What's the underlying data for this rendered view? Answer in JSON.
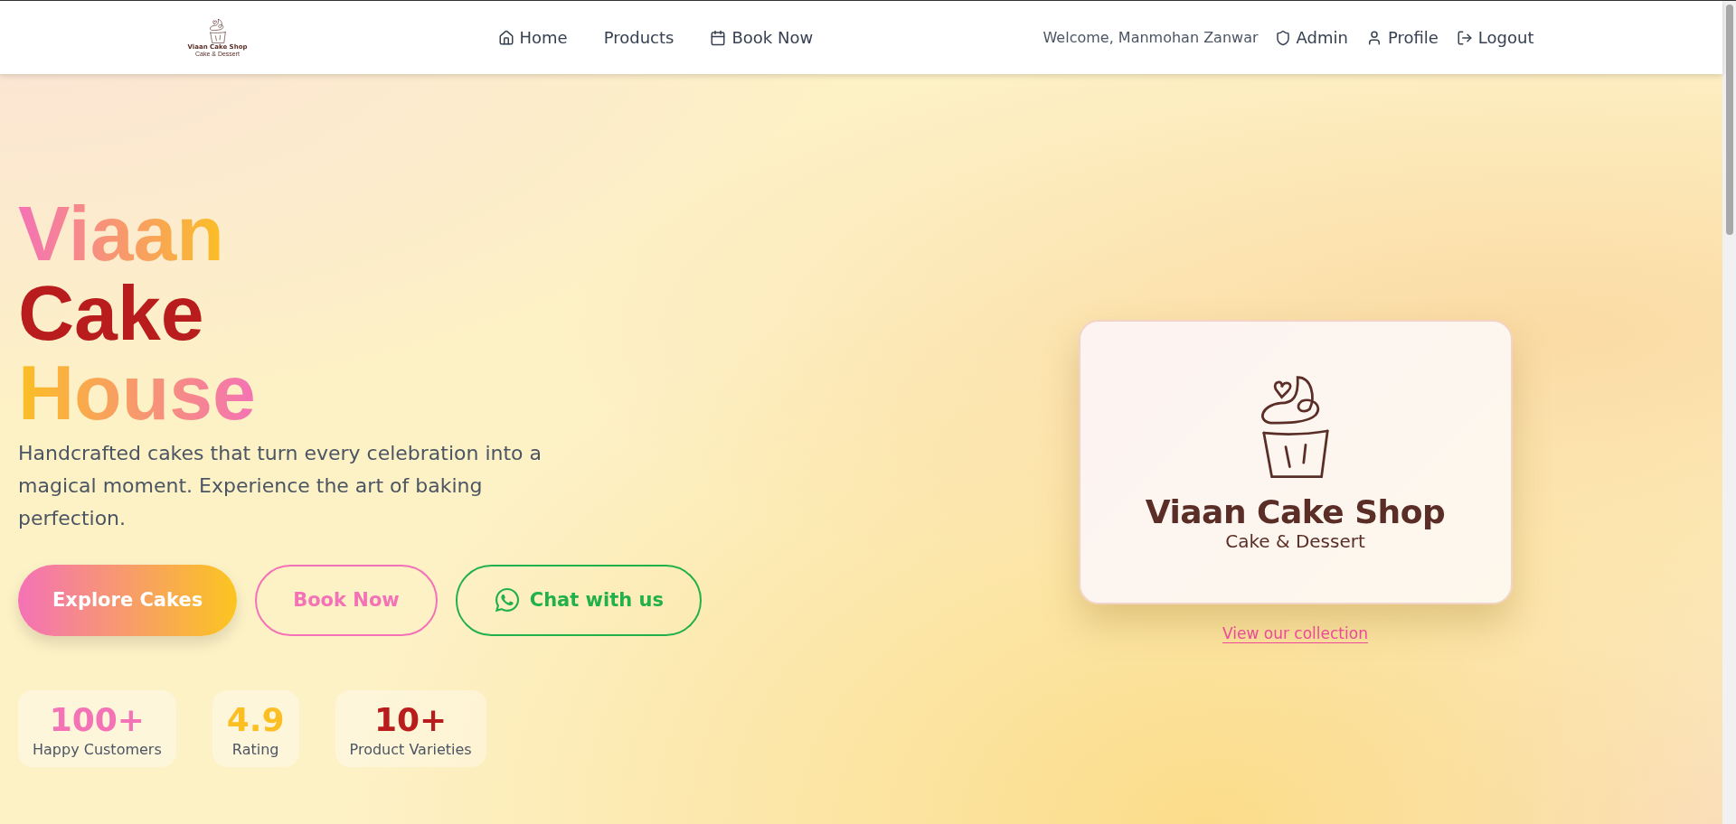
{
  "header": {
    "logo": {
      "name": "Viaan Cake Shop",
      "tagline": "Cake & Dessert"
    },
    "nav": [
      {
        "label": "Home",
        "kind": "home"
      },
      {
        "label": "Products",
        "kind": "plain"
      },
      {
        "label": "Book Now",
        "kind": "calendar"
      }
    ],
    "welcome": "Welcome, Manmohan Zanwar",
    "actions": [
      {
        "label": "Admin",
        "kind": "shield"
      },
      {
        "label": "Profile",
        "kind": "user"
      },
      {
        "label": "Logout",
        "kind": "logout"
      }
    ]
  },
  "hero": {
    "title_lines": [
      {
        "text": "Viaan",
        "kind": "warm"
      },
      {
        "text": "Cake",
        "kind": "solid"
      },
      {
        "text": "House",
        "kind": "warm-reverse"
      }
    ],
    "description": "Handcrafted cakes that turn every celebration into a magical moment. Experience the art of baking perfection.",
    "buttons": [
      {
        "label": "Explore Cakes",
        "kind": "gradient"
      },
      {
        "label": "Book Now",
        "kind": "outline-pink"
      },
      {
        "label": "Chat with us",
        "kind": "whatsapp"
      }
    ],
    "stats": [
      {
        "value": "100+",
        "label": "Happy Customers",
        "color": "#f472b6"
      },
      {
        "value": "4.9",
        "label": "Rating",
        "color": "#fbbf24"
      },
      {
        "value": "10+",
        "label": "Product Varieties",
        "color": "#b91c1c"
      }
    ],
    "card": {
      "name": "Viaan Cake Shop",
      "tagline": "Cake & Dessert"
    },
    "link": "View our collection"
  }
}
